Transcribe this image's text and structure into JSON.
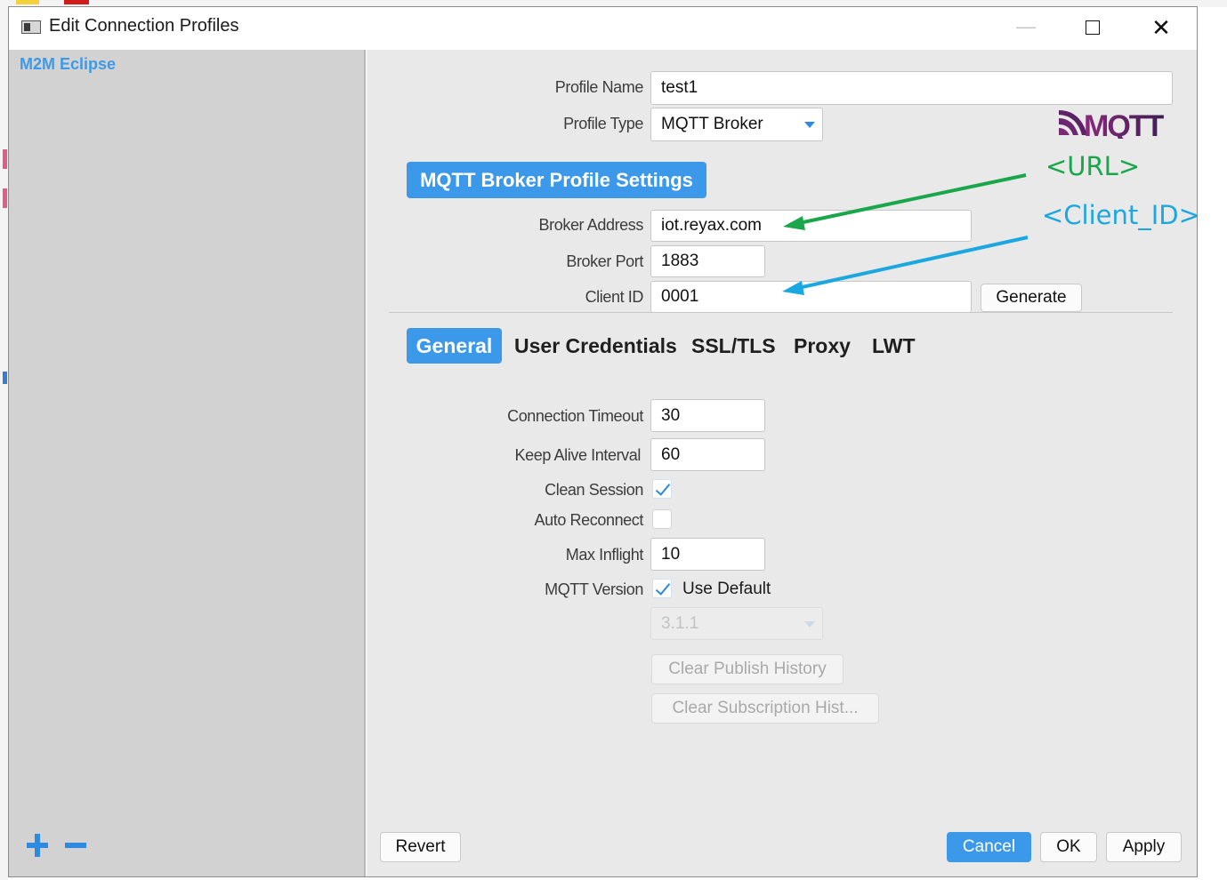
{
  "window": {
    "title": "Edit Connection Profiles",
    "minimize_symbol": "—",
    "close_symbol": "✕"
  },
  "sidebar": {
    "items": [
      {
        "label": "M2M Eclipse"
      }
    ],
    "add_icon": "plus-icon",
    "remove_icon": "minus-icon"
  },
  "profile": {
    "name_label": "Profile Name",
    "name_value": "test1",
    "type_label": "Profile Type",
    "type_value": "MQTT Broker",
    "logo_text": "MQTT"
  },
  "broker_settings": {
    "section_title": "MQTT Broker Profile Settings",
    "address_label": "Broker Address",
    "address_value": "iot.reyax.com",
    "port_label": "Broker Port",
    "port_value": "1883",
    "client_id_label": "Client ID",
    "client_id_value": "0001",
    "generate_label": "Generate"
  },
  "tabs": [
    {
      "label": "General",
      "active": true
    },
    {
      "label": "User Credentials",
      "active": false
    },
    {
      "label": "SSL/TLS",
      "active": false
    },
    {
      "label": "Proxy",
      "active": false
    },
    {
      "label": "LWT",
      "active": false
    }
  ],
  "general": {
    "connection_timeout_label": "Connection Timeout",
    "connection_timeout_value": "30",
    "keep_alive_label": "Keep Alive Interval",
    "keep_alive_value": "60",
    "clean_session_label": "Clean Session",
    "clean_session_checked": true,
    "auto_reconnect_label": "Auto Reconnect",
    "auto_reconnect_checked": false,
    "max_inflight_label": "Max Inflight",
    "max_inflight_value": "10",
    "mqtt_version_label": "MQTT Version",
    "use_default_label": "Use Default",
    "use_default_checked": true,
    "version_value": "3.1.1",
    "clear_publish_label": "Clear Publish History",
    "clear_subscription_label": "Clear Subscription Hist..."
  },
  "footer": {
    "revert_label": "Revert",
    "cancel_label": "Cancel",
    "ok_label": "OK",
    "apply_label": "Apply"
  },
  "annotations": {
    "url_label": "<URL>",
    "client_id_label": "<Client_ID>",
    "url_color": "#1aa64a",
    "client_id_color": "#1ba7e0"
  },
  "colors": {
    "accent": "#3c99ea",
    "sidebar_bg": "#d2d2d2",
    "panel_bg": "#e9e9e9"
  }
}
